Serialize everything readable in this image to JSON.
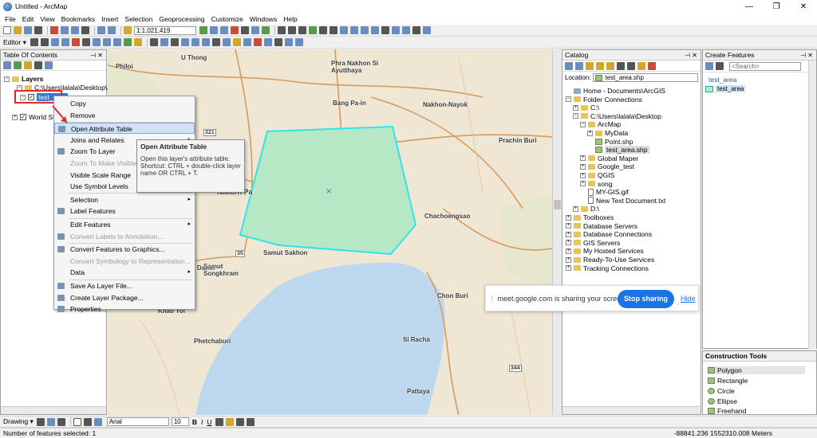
{
  "window": {
    "title": "Untitled - ArcMap",
    "controls": [
      "—",
      "❐",
      "✕"
    ]
  },
  "menu": [
    "File",
    "Edit",
    "View",
    "Bookmarks",
    "Insert",
    "Selection",
    "Geoprocessing",
    "Customize",
    "Windows",
    "Help"
  ],
  "toolbar": {
    "scale": "1:1,021,419",
    "editor_label": "Editor ▾"
  },
  "toc": {
    "title": "Table Of Contents",
    "layers_label": "Layers",
    "items": [
      "C:\\Users\\lalala\\Desktop\\Ar",
      "test_area",
      "World Str"
    ]
  },
  "context_menu": {
    "items": [
      {
        "label": "Copy",
        "disabled": false
      },
      {
        "label": "Remove",
        "disabled": false
      },
      {
        "label": "Open Attribute Table",
        "disabled": false,
        "highlighted": true
      },
      {
        "label": "Joins and Relates",
        "disabled": false,
        "submenu": true
      },
      {
        "label": "Zoom To Layer",
        "disabled": false
      },
      {
        "label": "Zoom To Make Visible",
        "disabled": true
      },
      {
        "label": "Visible Scale Range",
        "disabled": false
      },
      {
        "label": "Use Symbol Levels",
        "disabled": false
      },
      {
        "label": "Selection",
        "disabled": false,
        "submenu": true
      },
      {
        "label": "Label Features",
        "disabled": false
      },
      {
        "label": "Edit Features",
        "disabled": false,
        "submenu": true
      },
      {
        "label": "Convert Labels to Annotation...",
        "disabled": true
      },
      {
        "label": "Convert Features to Graphics...",
        "disabled": false
      },
      {
        "label": "Convert Symbology to Representation...",
        "disabled": true
      },
      {
        "label": "Data",
        "disabled": false,
        "submenu": true
      },
      {
        "label": "Save As Layer File...",
        "disabled": false
      },
      {
        "label": "Create Layer Package...",
        "disabled": false
      },
      {
        "label": "Properties...",
        "disabled": false
      }
    ]
  },
  "tooltip": {
    "title": "Open Attribute Table",
    "body": "Open this layer's attribute table. Shortcut: CTRL + double-click layer name OR CTRL + T."
  },
  "map": {
    "labels": [
      "U Thong",
      "Phra Nakhon Si Ayutthaya",
      "Bang Pa-in",
      "Nakhon-Nayok",
      "Prachin Buri",
      "Chachoengsao",
      "Nakorn Pa",
      "Samut Sakhon",
      "Samut Songkhram",
      "Chon Buri",
      "Khao Yoi",
      "Phetchaburi",
      "Si Racha",
      "Pattaya",
      "Philoi",
      "Damn"
    ],
    "road_shields": [
      "321",
      "35",
      "344"
    ],
    "colors": {
      "land": "#efe6d3",
      "water": "#bcd7ee",
      "polygon_fill": "#b7e8c6",
      "polygon_stroke": "#2ee5ec"
    }
  },
  "catalog": {
    "title": "Catalog",
    "location_label": "Location:",
    "location_value": "test_area.shp",
    "tree": [
      {
        "label": "Home - Documents\\ArcGIS",
        "level": 0,
        "icon": "home"
      },
      {
        "label": "Folder Connections",
        "level": 0,
        "icon": "folder",
        "expanded": true
      },
      {
        "label": "C:\\",
        "level": 1,
        "icon": "folder"
      },
      {
        "label": "C:\\Users\\lalala\\Desktop",
        "level": 1,
        "icon": "folder",
        "expanded": true
      },
      {
        "label": "ArcMap",
        "level": 2,
        "icon": "folder",
        "expanded": true
      },
      {
        "label": "MyData",
        "level": 3,
        "icon": "folder"
      },
      {
        "label": "Point.shp",
        "level": 3,
        "icon": "shp"
      },
      {
        "label": "test_area.shp",
        "level": 3,
        "icon": "shp",
        "selected": true
      },
      {
        "label": "Global Maper",
        "level": 2,
        "icon": "folder"
      },
      {
        "label": "Google_test",
        "level": 2,
        "icon": "folder"
      },
      {
        "label": "QGIS",
        "level": 2,
        "icon": "folder"
      },
      {
        "label": "song",
        "level": 2,
        "icon": "folder"
      },
      {
        "label": "MY-GIS.gif",
        "level": 2,
        "icon": "file"
      },
      {
        "label": "New Text Document.txt",
        "level": 2,
        "icon": "file"
      },
      {
        "label": "D:\\",
        "level": 1,
        "icon": "folder"
      },
      {
        "label": "Toolboxes",
        "level": 0,
        "icon": "folder"
      },
      {
        "label": "Database Servers",
        "level": 0,
        "icon": "folder"
      },
      {
        "label": "Database Connections",
        "level": 0,
        "icon": "folder"
      },
      {
        "label": "GIS Servers",
        "level": 0,
        "icon": "folder"
      },
      {
        "label": "My Hosted Services",
        "level": 0,
        "icon": "folder"
      },
      {
        "label": "Ready-To-Use Services",
        "level": 0,
        "icon": "folder"
      },
      {
        "label": "Tracking Connections",
        "level": 0,
        "icon": "folder"
      }
    ]
  },
  "create_features": {
    "title": "Create Features",
    "search_placeholder": "<Search>",
    "layer_name": "test_area",
    "template_name": "test_area",
    "construction_title": "Construction Tools",
    "tools": [
      "Polygon",
      "Rectangle",
      "Circle",
      "Ellipse",
      "Freehand"
    ]
  },
  "share_bar": {
    "message": "meet.google.com is sharing your screen.",
    "stop_label": "Stop sharing",
    "hide_label": "Hide"
  },
  "drawing_toolbar": {
    "label": "Drawing ▾",
    "font": "Arial",
    "size": "10",
    "bold": "B",
    "italic": "I",
    "underline": "U"
  },
  "status": {
    "selected_text": "Number of features selected: 1",
    "coords": "-88841.236  1552310.008 Meters"
  }
}
